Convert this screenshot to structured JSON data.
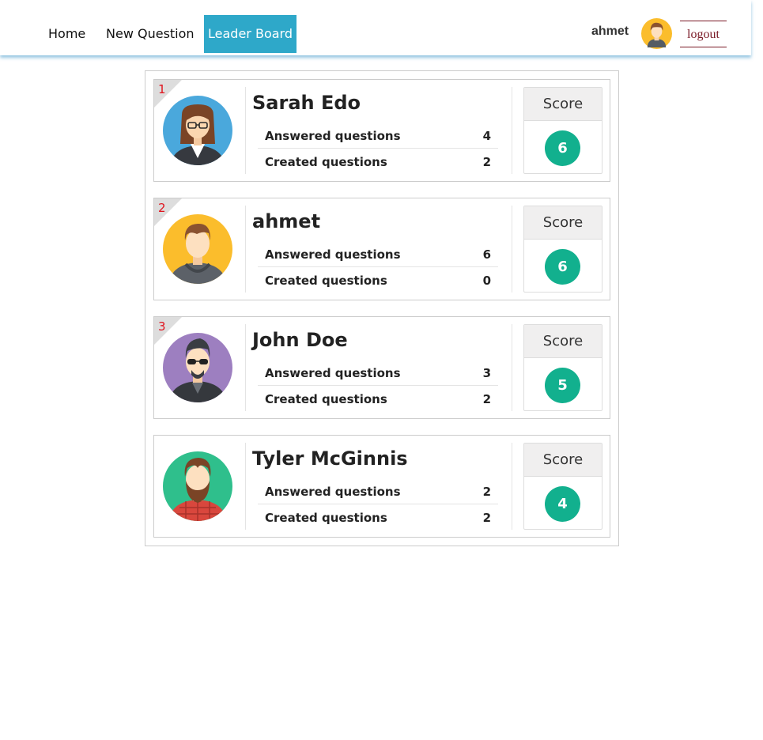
{
  "nav": {
    "home_label": "Home",
    "new_question_label": "New Question",
    "leaderboard_label": "Leader Board",
    "user_name": "ahmet",
    "logout_label": "logout",
    "accent_color": "#2ea8c9"
  },
  "leaderboard": {
    "score_label": "Score",
    "answered_label": "Answered questions",
    "created_label": "Created questions",
    "score_color": "#12b08e",
    "rank_color": "#e0141e",
    "entries": [
      {
        "rank": "1",
        "name": "Sarah Edo",
        "answered": "4",
        "created": "2",
        "score": "6",
        "avatar_icon": "woman-glasses-avatar-icon"
      },
      {
        "rank": "2",
        "name": "ahmet",
        "answered": "6",
        "created": "0",
        "score": "6",
        "avatar_icon": "man-hoodie-avatar-icon"
      },
      {
        "rank": "3",
        "name": "John Doe",
        "answered": "3",
        "created": "2",
        "score": "5",
        "avatar_icon": "man-sunglasses-avatar-icon"
      },
      {
        "rank": "",
        "name": "Tyler McGinnis",
        "answered": "2",
        "created": "2",
        "score": "4",
        "avatar_icon": "man-beard-avatar-icon"
      }
    ]
  }
}
